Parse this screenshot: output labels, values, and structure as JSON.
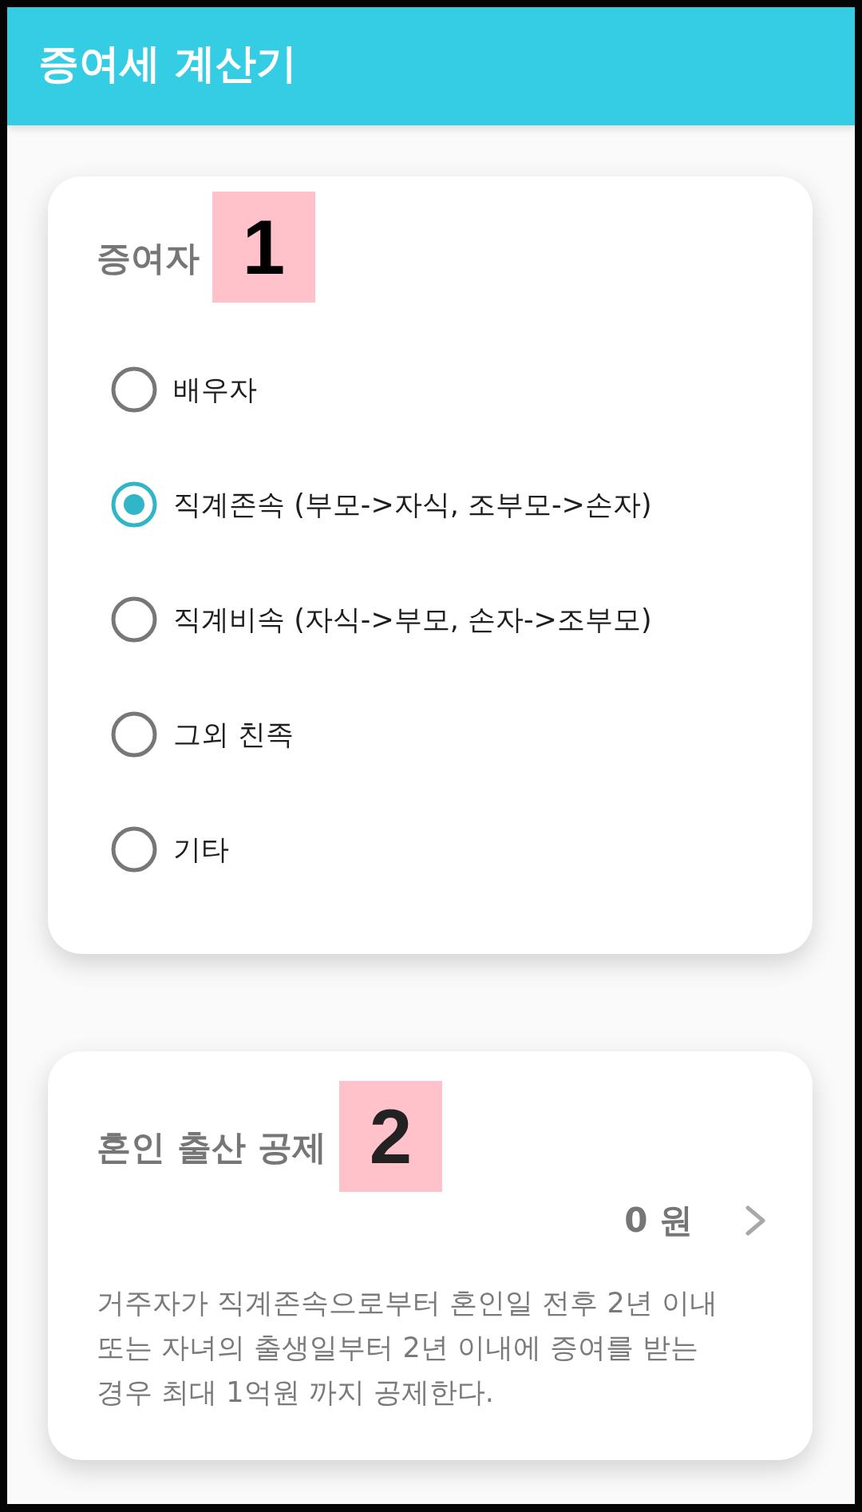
{
  "app_bar": {
    "title": "증여세 계산기"
  },
  "donor_section": {
    "title": "증여자",
    "marker": "1",
    "options": [
      {
        "label": "배우자",
        "selected": false
      },
      {
        "label": "직계존속 (부모->자식, 조부모->손자)",
        "selected": true
      },
      {
        "label": "직계비속 (자식->부모, 손자->조부모)",
        "selected": false
      },
      {
        "label": "그외 친족",
        "selected": false
      },
      {
        "label": "기타",
        "selected": false
      }
    ]
  },
  "deduction_section": {
    "title": "혼인 출산 공제",
    "marker": "2",
    "amount": "0 원",
    "description": "거주자가 직계존속으로부터 혼인일 전후 2년 이내 또는 자녀의 출생일부터 2년 이내에 증여를 받는 경우 최대 1억원 까지 공제한다."
  }
}
